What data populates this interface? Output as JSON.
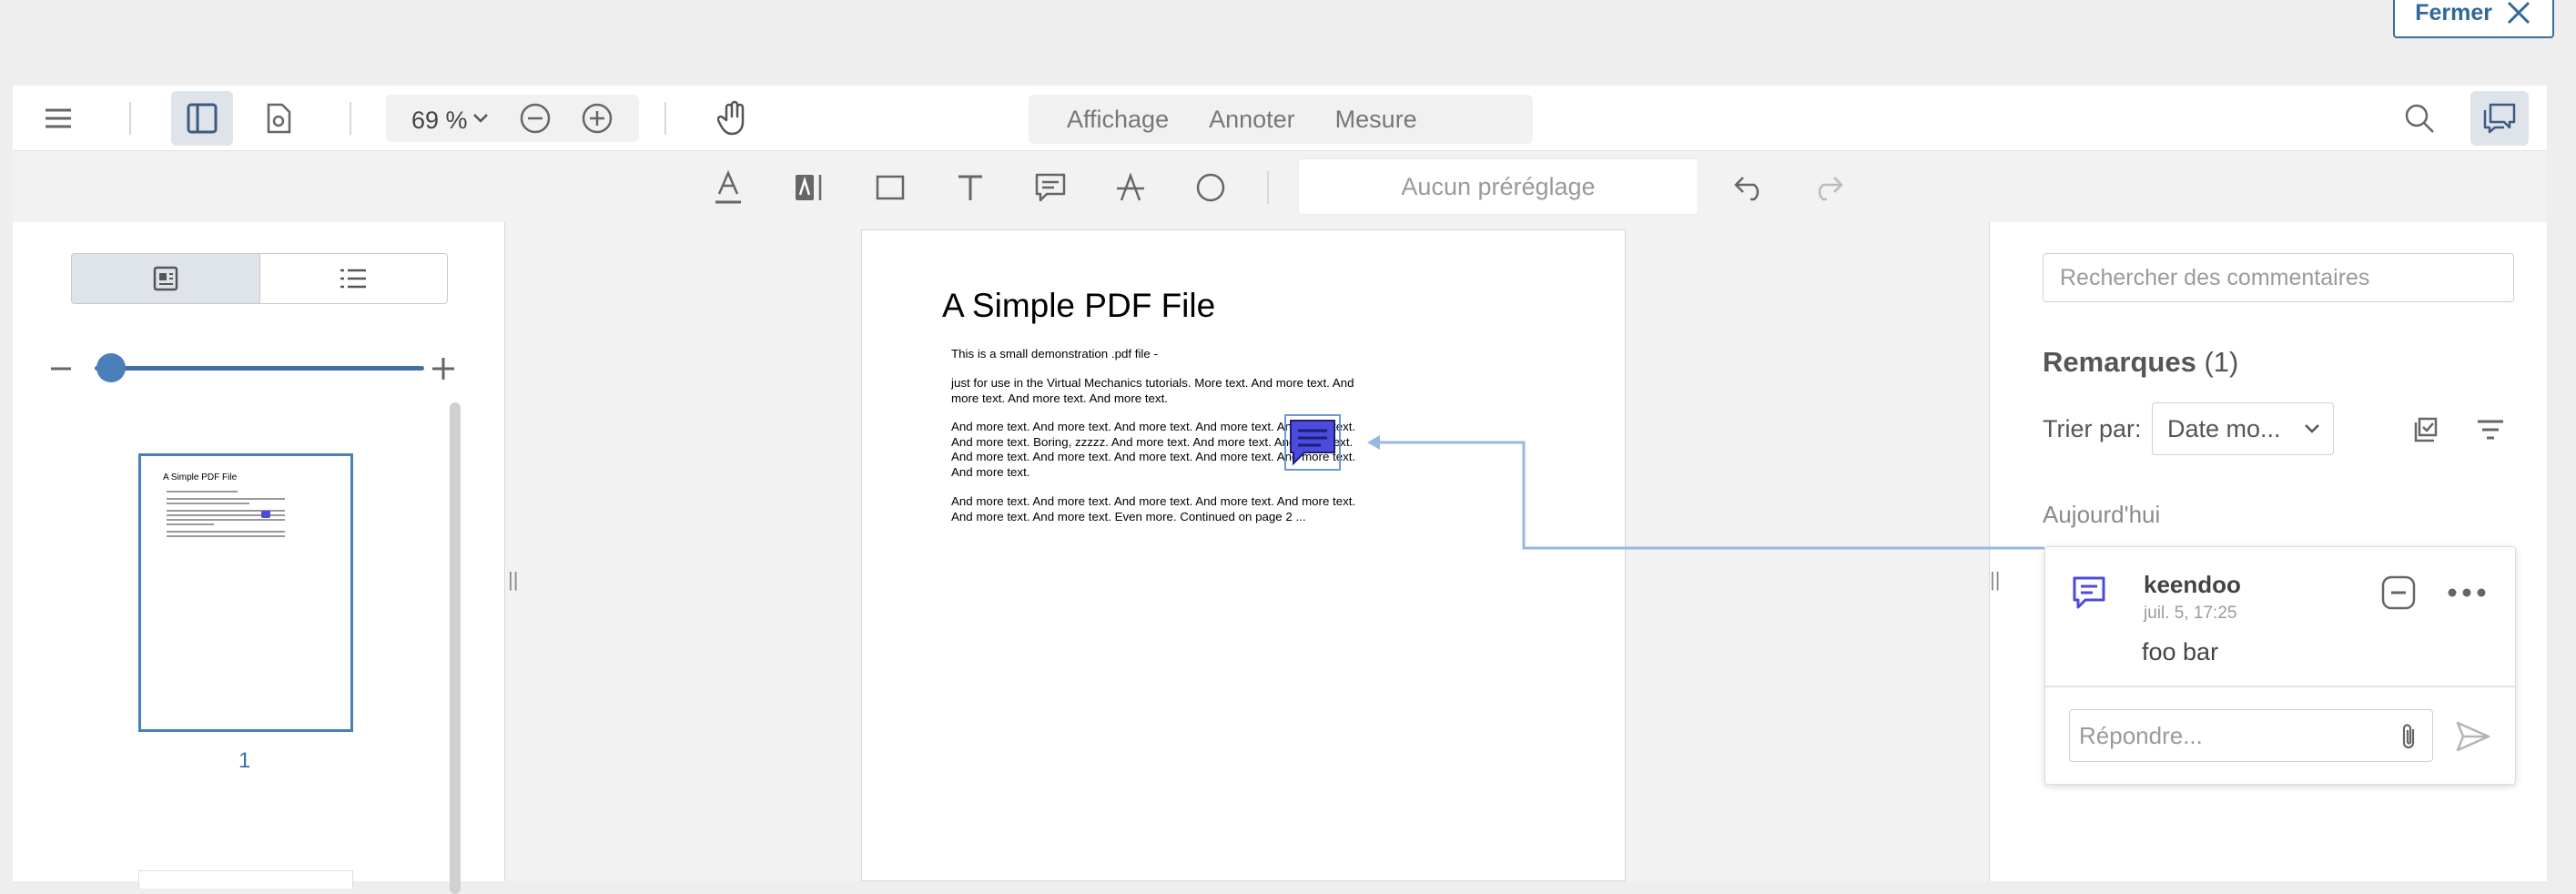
{
  "close_label": "Fermer",
  "toolbar": {
    "zoom": "69 %",
    "modes": [
      "Affichage",
      "Annoter",
      "Mesure"
    ],
    "preset_placeholder": "Aucun préréglage"
  },
  "left_panel": {
    "page_number": "1"
  },
  "document": {
    "title": "A Simple PDF File",
    "paragraphs": [
      "This is a small demonstration .pdf file -",
      "just for use in the Virtual Mechanics tutorials. More text. And more text. And more text. And more text. And more text.",
      "And more text. And more text. And more text. And more text. And more text. And more text. Boring, zzzzz. And more text. And more text. And more text. And more text. And more text. And more text. And more text. And more text. And more text.",
      "And more text. And more text. And more text. And more text. And more text. And more text. And more text. Even more. Continued on page 2 ..."
    ]
  },
  "comments_panel": {
    "search_placeholder": "Rechercher des commentaires",
    "heading": "Remarques",
    "count": "(1)",
    "sort_label": "Trier par:",
    "sort_value": "Date mo...",
    "group_label": "Aujourd'hui",
    "note": {
      "author": "keendoo",
      "date": "juil. 5, 17:25",
      "body": "foo bar",
      "reply_placeholder": "Répondre..."
    }
  },
  "colors": {
    "accent": "#3f6fa6",
    "annotation": "#4b4bdc",
    "connector": "#9ab6e2"
  }
}
